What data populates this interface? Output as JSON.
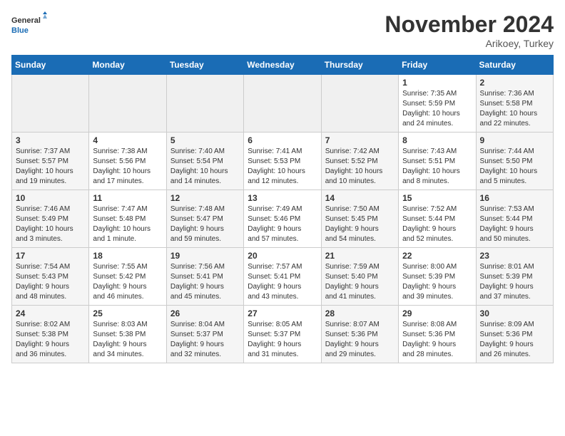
{
  "logo": {
    "text_general": "General",
    "text_blue": "Blue"
  },
  "header": {
    "month": "November 2024",
    "location": "Arikoey, Turkey"
  },
  "weekdays": [
    "Sunday",
    "Monday",
    "Tuesday",
    "Wednesday",
    "Thursday",
    "Friday",
    "Saturday"
  ],
  "weeks": [
    [
      {
        "day": "",
        "info": ""
      },
      {
        "day": "",
        "info": ""
      },
      {
        "day": "",
        "info": ""
      },
      {
        "day": "",
        "info": ""
      },
      {
        "day": "",
        "info": ""
      },
      {
        "day": "1",
        "info": "Sunrise: 7:35 AM\nSunset: 5:59 PM\nDaylight: 10 hours\nand 24 minutes."
      },
      {
        "day": "2",
        "info": "Sunrise: 7:36 AM\nSunset: 5:58 PM\nDaylight: 10 hours\nand 22 minutes."
      }
    ],
    [
      {
        "day": "3",
        "info": "Sunrise: 7:37 AM\nSunset: 5:57 PM\nDaylight: 10 hours\nand 19 minutes."
      },
      {
        "day": "4",
        "info": "Sunrise: 7:38 AM\nSunset: 5:56 PM\nDaylight: 10 hours\nand 17 minutes."
      },
      {
        "day": "5",
        "info": "Sunrise: 7:40 AM\nSunset: 5:54 PM\nDaylight: 10 hours\nand 14 minutes."
      },
      {
        "day": "6",
        "info": "Sunrise: 7:41 AM\nSunset: 5:53 PM\nDaylight: 10 hours\nand 12 minutes."
      },
      {
        "day": "7",
        "info": "Sunrise: 7:42 AM\nSunset: 5:52 PM\nDaylight: 10 hours\nand 10 minutes."
      },
      {
        "day": "8",
        "info": "Sunrise: 7:43 AM\nSunset: 5:51 PM\nDaylight: 10 hours\nand 8 minutes."
      },
      {
        "day": "9",
        "info": "Sunrise: 7:44 AM\nSunset: 5:50 PM\nDaylight: 10 hours\nand 5 minutes."
      }
    ],
    [
      {
        "day": "10",
        "info": "Sunrise: 7:46 AM\nSunset: 5:49 PM\nDaylight: 10 hours\nand 3 minutes."
      },
      {
        "day": "11",
        "info": "Sunrise: 7:47 AM\nSunset: 5:48 PM\nDaylight: 10 hours\nand 1 minute."
      },
      {
        "day": "12",
        "info": "Sunrise: 7:48 AM\nSunset: 5:47 PM\nDaylight: 9 hours\nand 59 minutes."
      },
      {
        "day": "13",
        "info": "Sunrise: 7:49 AM\nSunset: 5:46 PM\nDaylight: 9 hours\nand 57 minutes."
      },
      {
        "day": "14",
        "info": "Sunrise: 7:50 AM\nSunset: 5:45 PM\nDaylight: 9 hours\nand 54 minutes."
      },
      {
        "day": "15",
        "info": "Sunrise: 7:52 AM\nSunset: 5:44 PM\nDaylight: 9 hours\nand 52 minutes."
      },
      {
        "day": "16",
        "info": "Sunrise: 7:53 AM\nSunset: 5:44 PM\nDaylight: 9 hours\nand 50 minutes."
      }
    ],
    [
      {
        "day": "17",
        "info": "Sunrise: 7:54 AM\nSunset: 5:43 PM\nDaylight: 9 hours\nand 48 minutes."
      },
      {
        "day": "18",
        "info": "Sunrise: 7:55 AM\nSunset: 5:42 PM\nDaylight: 9 hours\nand 46 minutes."
      },
      {
        "day": "19",
        "info": "Sunrise: 7:56 AM\nSunset: 5:41 PM\nDaylight: 9 hours\nand 45 minutes."
      },
      {
        "day": "20",
        "info": "Sunrise: 7:57 AM\nSunset: 5:41 PM\nDaylight: 9 hours\nand 43 minutes."
      },
      {
        "day": "21",
        "info": "Sunrise: 7:59 AM\nSunset: 5:40 PM\nDaylight: 9 hours\nand 41 minutes."
      },
      {
        "day": "22",
        "info": "Sunrise: 8:00 AM\nSunset: 5:39 PM\nDaylight: 9 hours\nand 39 minutes."
      },
      {
        "day": "23",
        "info": "Sunrise: 8:01 AM\nSunset: 5:39 PM\nDaylight: 9 hours\nand 37 minutes."
      }
    ],
    [
      {
        "day": "24",
        "info": "Sunrise: 8:02 AM\nSunset: 5:38 PM\nDaylight: 9 hours\nand 36 minutes."
      },
      {
        "day": "25",
        "info": "Sunrise: 8:03 AM\nSunset: 5:38 PM\nDaylight: 9 hours\nand 34 minutes."
      },
      {
        "day": "26",
        "info": "Sunrise: 8:04 AM\nSunset: 5:37 PM\nDaylight: 9 hours\nand 32 minutes."
      },
      {
        "day": "27",
        "info": "Sunrise: 8:05 AM\nSunset: 5:37 PM\nDaylight: 9 hours\nand 31 minutes."
      },
      {
        "day": "28",
        "info": "Sunrise: 8:07 AM\nSunset: 5:36 PM\nDaylight: 9 hours\nand 29 minutes."
      },
      {
        "day": "29",
        "info": "Sunrise: 8:08 AM\nSunset: 5:36 PM\nDaylight: 9 hours\nand 28 minutes."
      },
      {
        "day": "30",
        "info": "Sunrise: 8:09 AM\nSunset: 5:36 PM\nDaylight: 9 hours\nand 26 minutes."
      }
    ]
  ]
}
